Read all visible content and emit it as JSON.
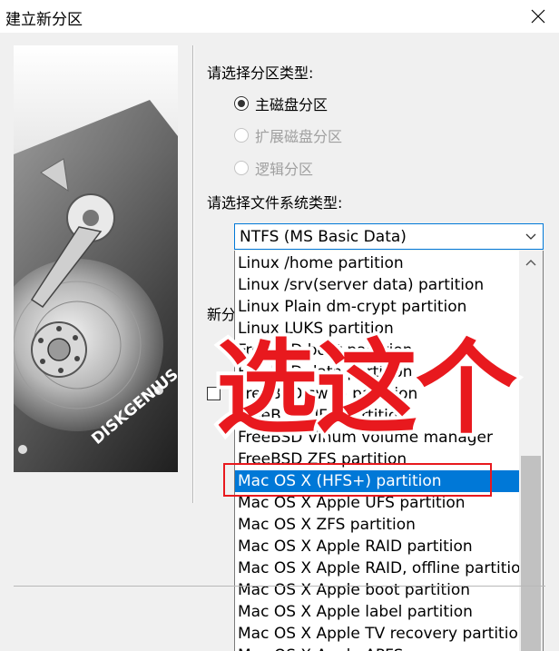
{
  "window": {
    "title": "建立新分区"
  },
  "partition_type": {
    "label": "请选择分区类型:",
    "options": [
      {
        "label": "主磁盘分区",
        "checked": true,
        "disabled": false
      },
      {
        "label": "扩展磁盘分区",
        "checked": false,
        "disabled": true
      },
      {
        "label": "逻辑分区",
        "checked": false,
        "disabled": true
      }
    ]
  },
  "filesystem": {
    "label": "请选择文件系统类型:",
    "selected_value": "NTFS (MS Basic Data)",
    "items": [
      "Linux /home partition",
      "Linux /srv(server data) partition",
      "Linux Plain dm-crypt partition",
      "Linux LUKS partition",
      "FreeBSD boot partition",
      "FreeBSD data partition",
      "FreeBSD swap partition",
      "FreeBSD UFS partition",
      "FreeBSD Vinum volume manager",
      "FreeBSD ZFS partition",
      "Mac OS X (HFS+) partition",
      "Mac OS X Apple UFS partition",
      "Mac OS X ZFS partition",
      "Mac OS X Apple RAID partition",
      "Mac OS X Apple RAID, offline partition",
      "Mac OS X Apple boot partition",
      "Mac OS X Apple label partition",
      "Mac OS X Apple TV recovery partition",
      "Mac OS X Apple APFS"
    ],
    "selected_index": 10
  },
  "hidden_label": "新分",
  "overlay": {
    "text": "选这个",
    "color": "#e8191e"
  },
  "logo": {
    "text": "DISKGENIUS"
  },
  "colors": {
    "accent": "#0078d7",
    "highlight": "#e8191e"
  }
}
